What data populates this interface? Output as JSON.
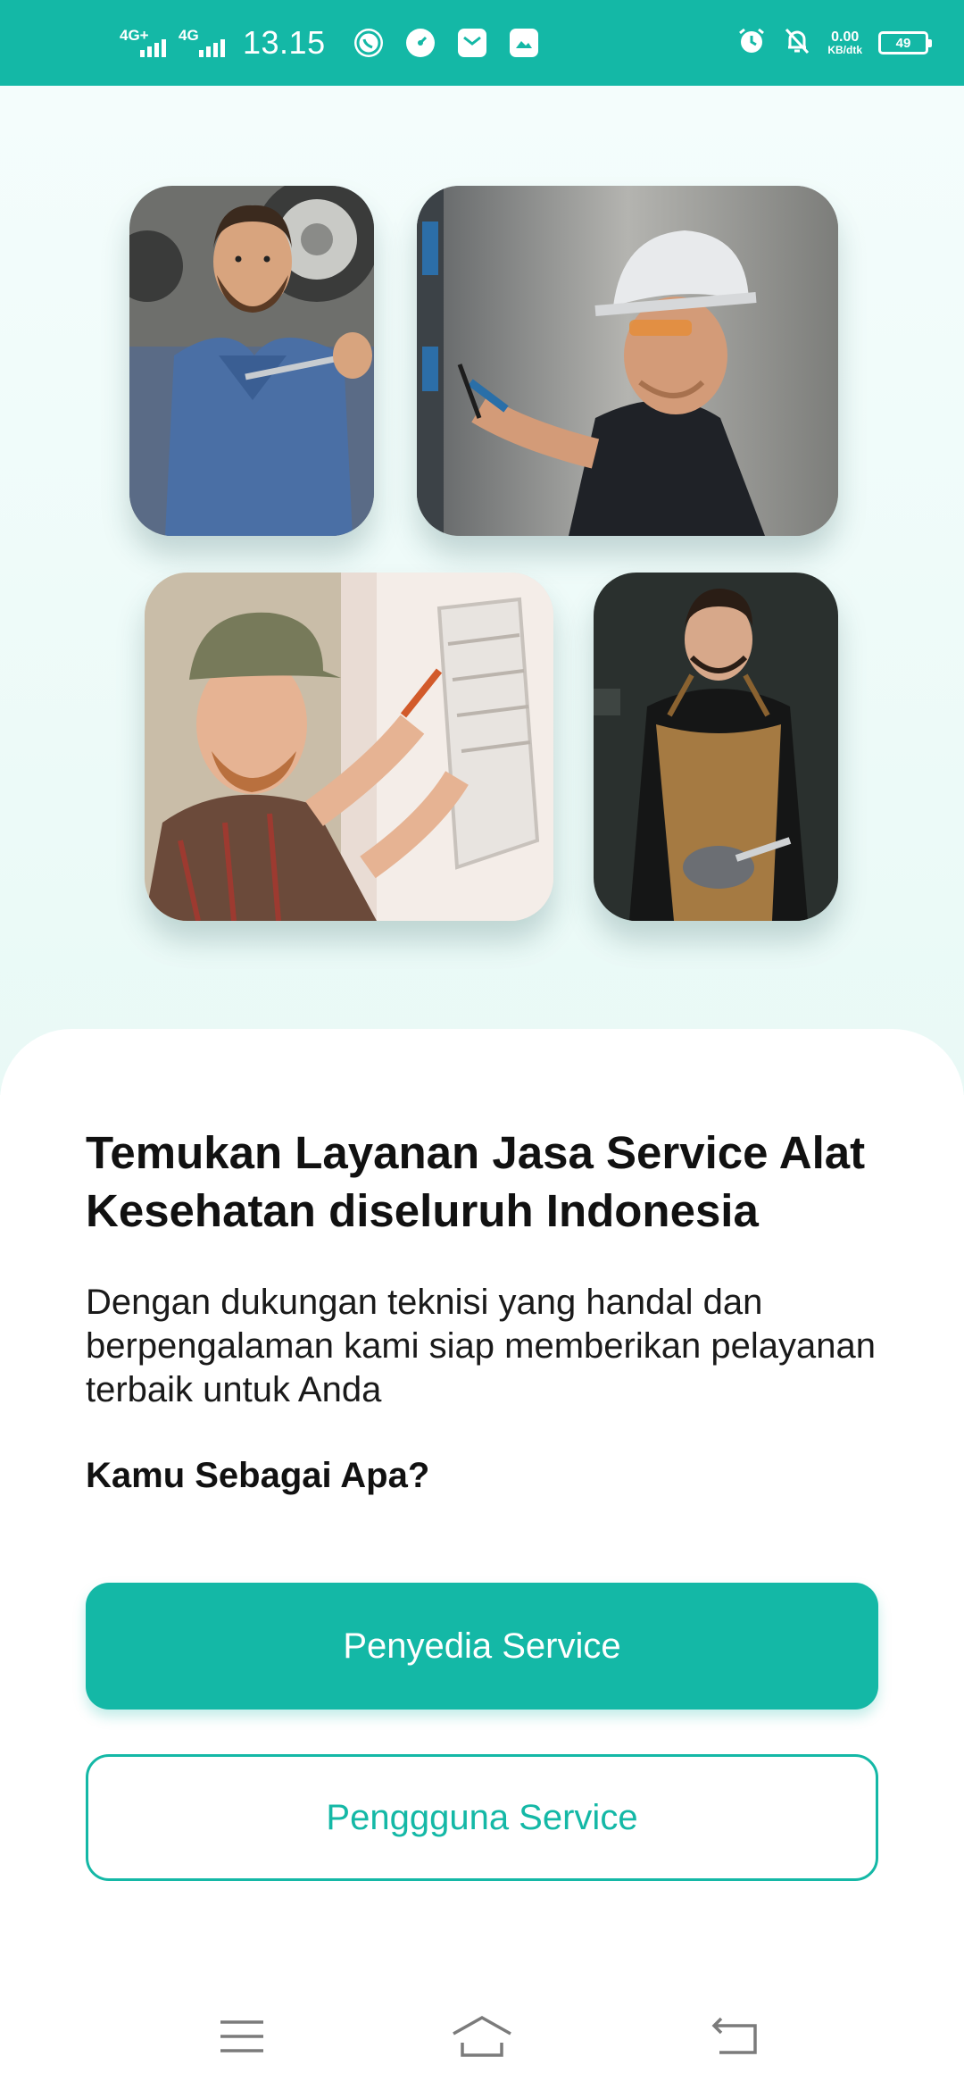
{
  "status_bar": {
    "network_1": "4G+",
    "network_2": "4G",
    "time": "13.15",
    "speed_value": "0.00",
    "speed_unit": "KB/dtk",
    "battery": "49",
    "icons": [
      "whatsapp-icon",
      "speedometer-icon",
      "mail-icon",
      "photo-icon",
      "alarm-icon",
      "mute-bell-icon"
    ]
  },
  "hero": {
    "photos": [
      "mechanic-photo",
      "electrician-photo",
      "ac-technician-photo",
      "apron-worker-photo"
    ]
  },
  "content": {
    "title": "Temukan Layanan Jasa Service Alat Kesehatan diseluruh Indonesia",
    "description": "Dengan dukungan teknisi yang handal dan berpengalaman kami siap memberikan pelayanan terbaik untuk Anda",
    "question": "Kamu Sebagai Apa?",
    "primary_button": "Penyedia Service",
    "secondary_button": "Penggguna Service"
  },
  "colors": {
    "accent": "#14b8a6",
    "hero_background": "#eefbf9",
    "text": "#111111"
  },
  "nav_bar": {
    "icons": [
      "menu-icon",
      "home-icon",
      "back-icon"
    ]
  }
}
